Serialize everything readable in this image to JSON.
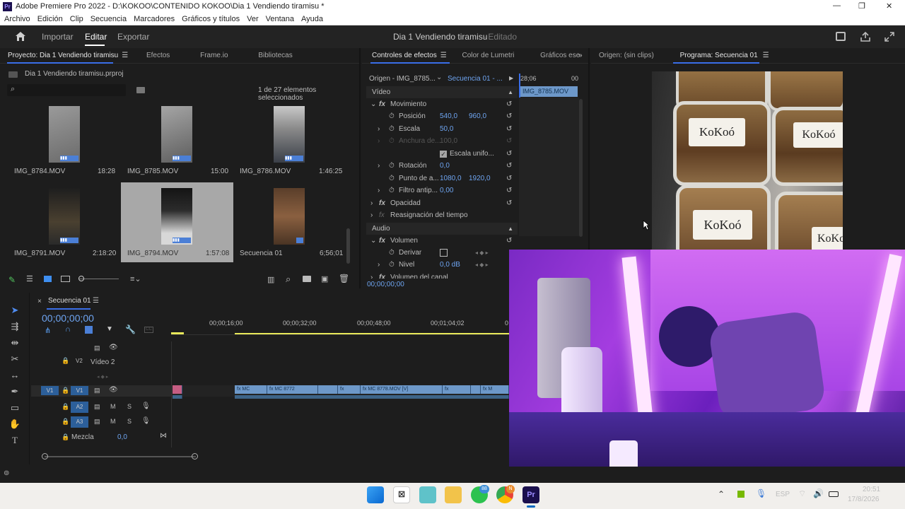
{
  "window": {
    "title": "Adobe Premiere Pro 2022 - D:\\KOKOO\\CONTENIDO KOKOO\\Dia 1 Vendiendo tiramisu *",
    "minimize": "—",
    "maximize": "❐",
    "close": "✕"
  },
  "menu": [
    "Archivo",
    "Edición",
    "Clip",
    "Secuencia",
    "Marcadores",
    "Gráficos y títulos",
    "Ver",
    "Ventana",
    "Ayuda"
  ],
  "header": {
    "tabs": [
      "Importar",
      "Editar",
      "Exportar"
    ],
    "active": "Editar",
    "project_name": "Dia 1 Vendiendo tiramisu",
    "status": "- Editado"
  },
  "project": {
    "tabs": [
      "Proyecto: Dia 1 Vendiendo tiramisu",
      "Efectos",
      "Frame.io",
      "Bibliotecas"
    ],
    "file": "Dia 1 Vendiendo tiramisu.prproj",
    "selection": "1 de 27 elementos seleccionados",
    "items": [
      {
        "name": "IMG_8784.MOV",
        "duration": "18:28"
      },
      {
        "name": "IMG_8785.MOV",
        "duration": "15:00"
      },
      {
        "name": "IMG_8786.MOV",
        "duration": "1:46:25"
      },
      {
        "name": "IMG_8791.MOV",
        "duration": "2:18:20"
      },
      {
        "name": "IMG_8794.MOV",
        "duration": "1:57:08"
      },
      {
        "name": "Secuencia 01",
        "duration": "6;56;01"
      }
    ]
  },
  "effects": {
    "tabs": [
      "Controles de efectos",
      "Color de Lumetri",
      "Gráficos ese"
    ],
    "source": "Origen - IMG_8785...",
    "sequence": "Secuencia 01 - ...",
    "mini_time_a": "28;06",
    "mini_time_b": "00",
    "clip_label": "IMG_8785.MOV",
    "video_header": "Vídeo",
    "motion": "Movimiento",
    "position_label": "Posición",
    "position_x": "540,0",
    "position_y": "960,0",
    "scale_label": "Escala",
    "scale": "50,0",
    "width_label": "Anchura de...",
    "width": "100,0",
    "uniform_label": "Escala unifo...",
    "rotation_label": "Rotación",
    "rotation": "0,0",
    "anchor_label": "Punto de a...",
    "anchor_x": "1080,0",
    "anchor_y": "1920,0",
    "filter_label": "Filtro antip...",
    "filter": "0,00",
    "opacity": "Opacidad",
    "time_remap": "Reasignación del tiempo",
    "audio_header": "Audio",
    "volume": "Volumen",
    "bypass_label": "Derivar",
    "level_label": "Nivel",
    "level": "0,0 dB",
    "channel_volume": "Volumen del canal",
    "timecode": "00;00;00;00"
  },
  "monitor": {
    "tabs": [
      "Origen: (sin clips)",
      "Programa: Secuencia 01"
    ],
    "labels": [
      "KoKoó",
      "KoKoó",
      "KoKoó",
      "KoKoó"
    ]
  },
  "timeline": {
    "tab": "Secuencia 01",
    "timecode": "00;00;00;00",
    "ruler": [
      "00;00;16;00",
      "00;00;32;00",
      "00;00;48;00",
      "00;01;04;02",
      "0"
    ],
    "v2_name": "Vídeo 2",
    "v1": "V1",
    "v2": "V2",
    "a2": "A2",
    "a3": "A3",
    "mix_label": "Mezcla",
    "mix_value": "0,0",
    "clips": [
      "fx MC",
      "fx MC 8772",
      "fx",
      "fx MC 8778.MOV [V]",
      "fx",
      "fx M"
    ]
  },
  "taskbar": {
    "lang": "ESP",
    "time": "20:51",
    "date": "17/8/2026",
    "badge1": "88",
    "badge2": "N"
  }
}
